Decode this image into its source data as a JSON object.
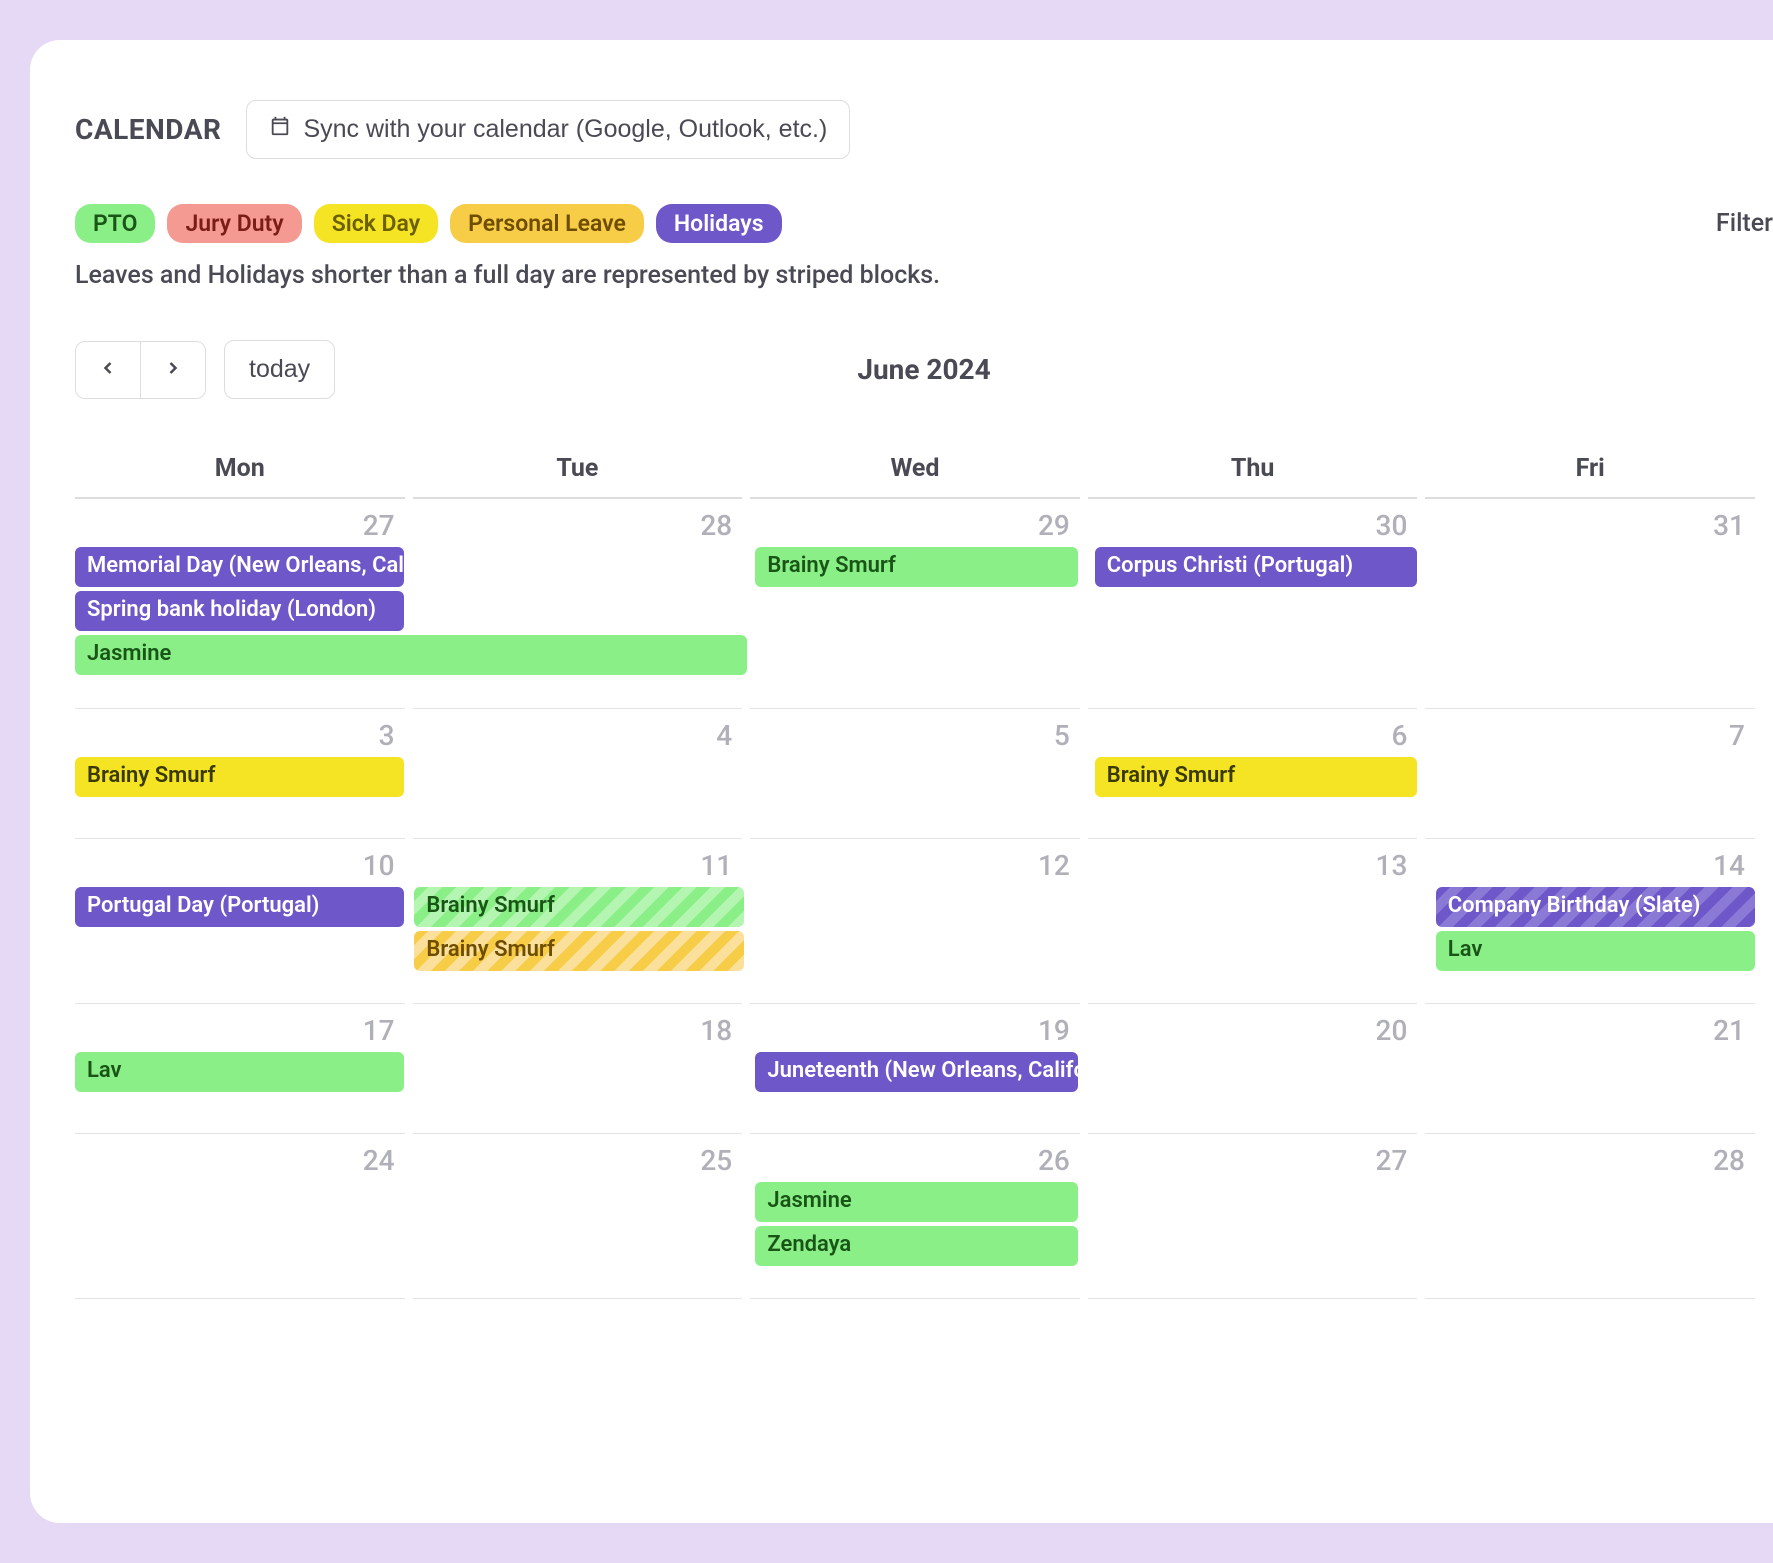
{
  "header": {
    "title": "CALENDAR",
    "sync_label": "Sync with your calendar (Google, Outlook, etc.)"
  },
  "legend": {
    "pto": "PTO",
    "jury": "Jury Duty",
    "sick": "Sick Day",
    "personal": "Personal Leave",
    "holiday": "Holidays",
    "filter": "Filter"
  },
  "note": "Leaves and Holidays shorter than a full day are represented by striped blocks.",
  "nav": {
    "today": "today",
    "period": "June 2024"
  },
  "days": [
    "Mon",
    "Tue",
    "Wed",
    "Thu",
    "Fri"
  ],
  "weeks": [
    {
      "dates": [
        "27",
        "28",
        "29",
        "30",
        "31"
      ]
    },
    {
      "dates": [
        "3",
        "4",
        "5",
        "6",
        "7"
      ]
    },
    {
      "dates": [
        "10",
        "11",
        "12",
        "13",
        "14"
      ]
    },
    {
      "dates": [
        "17",
        "18",
        "19",
        "20",
        "21"
      ]
    },
    {
      "dates": [
        "24",
        "25",
        "26",
        "27",
        "28"
      ]
    }
  ],
  "events": {
    "w0": {
      "memorial": "Memorial Day (New Orleans, California)",
      "spring": "Spring bank holiday (London)",
      "jasmine": "Jasmine",
      "brainy_wed": "Brainy Smurf",
      "corpus": "Corpus Christi (Portugal)"
    },
    "w1": {
      "brainy_mon": "Brainy Smurf",
      "brainy_thu": "Brainy Smurf"
    },
    "w2": {
      "portugal": "Portugal Day (Portugal)",
      "brainy1": "Brainy Smurf",
      "brainy2": "Brainy Smurf",
      "company": "Company Birthday (Slate)",
      "lav": "Lav"
    },
    "w3": {
      "lav": "Lav",
      "juneteenth": "Juneteenth (New Orleans, California)"
    },
    "w4": {
      "jasmine": "Jasmine",
      "zendaya": "Zendaya"
    }
  }
}
